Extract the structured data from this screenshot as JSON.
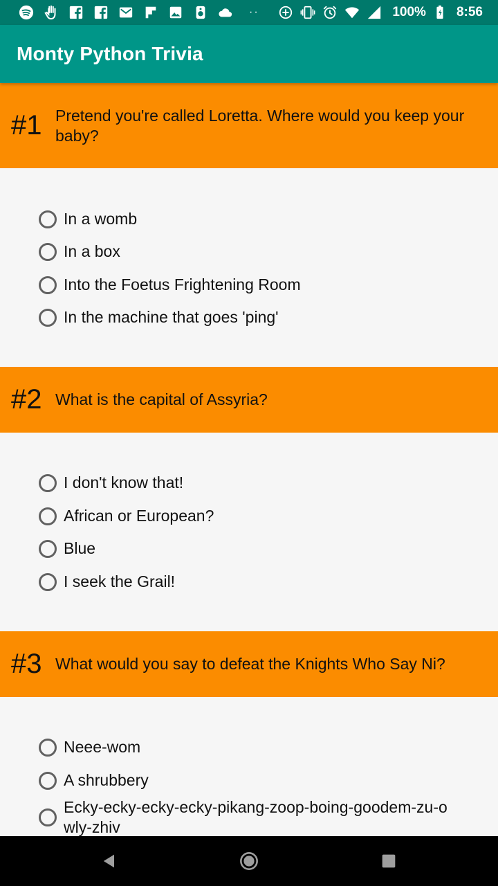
{
  "status_bar": {
    "left_icons": [
      "spotify-icon",
      "hand-icon",
      "facebook-icon",
      "facebook-icon",
      "gmail-icon",
      "flipboard-icon",
      "photo-icon",
      "speaker-icon",
      "cloud-icon"
    ],
    "dots": "··",
    "right_icons": [
      "data-saver-icon",
      "vibrate-icon",
      "alarm-icon",
      "wifi-icon",
      "signal-icon"
    ],
    "battery": "100%",
    "time": "8:56"
  },
  "app": {
    "title": "Monty Python Trivia"
  },
  "questions": [
    {
      "number": "#1",
      "text": "Pretend you're called Loretta. Where would you keep your baby?",
      "options": [
        "In a womb",
        "In a box",
        "Into the Foetus Frightening Room",
        "In the machine that goes 'ping'"
      ]
    },
    {
      "number": "#2",
      "text": "What is the capital of Assyria?",
      "options": [
        "I don't know that!",
        "African or European?",
        "Blue",
        "I seek the Grail!"
      ]
    },
    {
      "number": "#3",
      "text": "What would you say to defeat the Knights Who Say Ni?",
      "options": [
        "Neee-wom",
        "A shrubbery",
        "Ecky-ecky-ecky-ecky-pikang-zoop-boing-goodem-zu-owly-zhiv"
      ]
    }
  ],
  "nav": [
    "back-icon",
    "home-icon",
    "recents-icon"
  ],
  "colors": {
    "status_bar": "#00796b",
    "app_bar": "#009688",
    "question_header": "#fb8c00",
    "background": "#f6f6f6"
  }
}
